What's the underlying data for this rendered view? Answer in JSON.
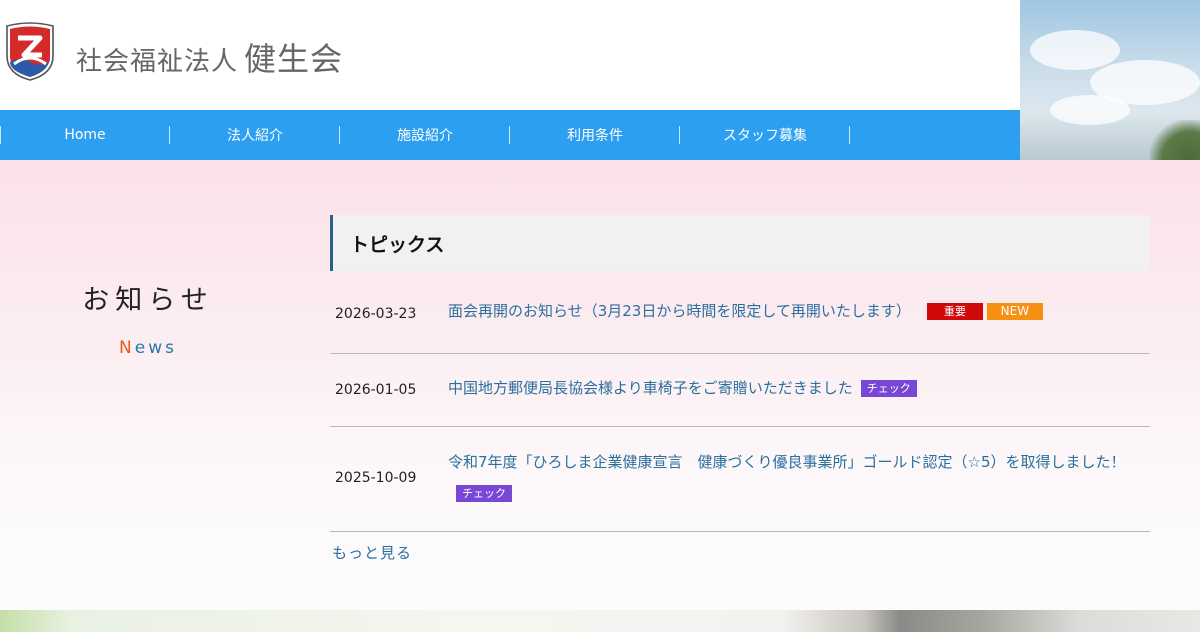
{
  "header": {
    "title_prefix": "社会福祉法人",
    "title_name": "健生会",
    "logo_text": "Z"
  },
  "nav": {
    "items": [
      {
        "label": "Home"
      },
      {
        "label": "法人紹介"
      },
      {
        "label": "施設紹介"
      },
      {
        "label": "利用条件"
      },
      {
        "label": "スタッフ募集"
      }
    ]
  },
  "sidebar": {
    "title": "お知らせ",
    "sub_first": "N",
    "sub_rest": "ews"
  },
  "topics": {
    "heading": "トピックス",
    "items": [
      {
        "date": "2026-03-23",
        "title": "面会再開のお知らせ（3月23日から時間を限定して再開いたします）",
        "badges": [
          "重要",
          "NEW"
        ]
      },
      {
        "date": "2026-01-05",
        "title": "中国地方郵便局長協会様より車椅子をご寄贈いただきました",
        "badges": [
          "チェック"
        ]
      },
      {
        "date": "2025-10-09",
        "title": "令和7年度「ひろしま企業健康宣言　健康づくり優良事業所」ゴールド認定（☆5）を取得しました！",
        "badges": [
          "チェック"
        ]
      }
    ],
    "more_label": "もっと見る"
  },
  "colors": {
    "nav_bg": "#2d9ff0",
    "link": "#2b6f9e",
    "badge_important": "#d00a0a",
    "badge_new": "#f59012",
    "badge_check": "#7847d6",
    "heading_border": "#2b5f8c"
  }
}
